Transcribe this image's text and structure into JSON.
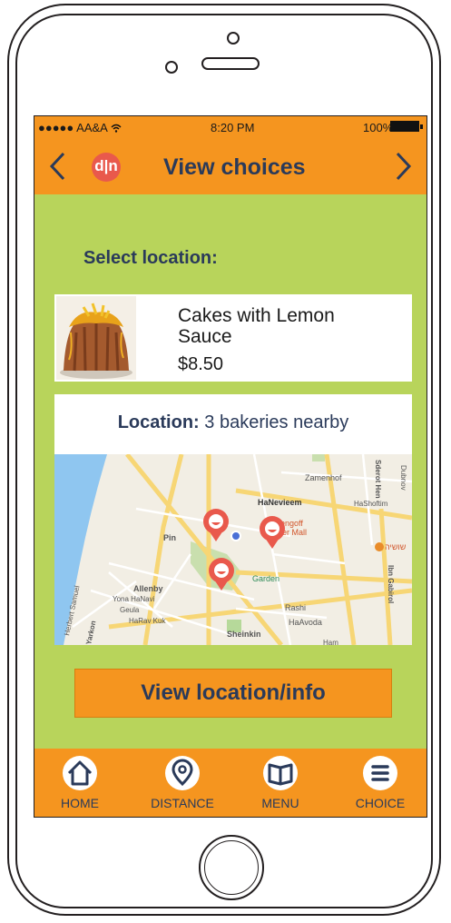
{
  "status_bar": {
    "carrier": "●●●●● AA&A",
    "wifi_icon": "wifi-icon",
    "time": "8:20 PM",
    "battery": "100%"
  },
  "nav": {
    "title": "View choices",
    "logo_text": "d|n",
    "back_icon": "chevron-left-icon",
    "forward_icon": "chevron-right-icon"
  },
  "page": {
    "select_location_label": "Select location:"
  },
  "item": {
    "name": "Cakes with Lemon Sauce",
    "price": "$8.50"
  },
  "location": {
    "label": "Location:",
    "summary": " 3 bakeries nearby"
  },
  "map": {
    "streets": [
      "Zamenhof",
      "HaNevieem",
      "HaShoftim",
      "Dubnov",
      "Sderot Hen",
      "Ibn Gabirol",
      "Allenby",
      "Yona HaNavi",
      "Geula",
      "HaRav Kuk",
      "Herbert Samuel",
      "Yarkon",
      "Rashi",
      "HaAvoda",
      "Sheinkin",
      "Pin",
      "Ham",
      "Garden",
      "Dizengoff Center Mall",
      "שושיה"
    ],
    "markers": 3
  },
  "action": {
    "view_button": "View location/info"
  },
  "tabs": [
    {
      "label": "HOME",
      "icon": "home-icon"
    },
    {
      "label": "DISTANCE",
      "icon": "map-pin-icon"
    },
    {
      "label": "MENU",
      "icon": "book-icon"
    },
    {
      "label": "CHOICE",
      "icon": "list-icon"
    }
  ],
  "colors": {
    "orange": "#f5951f",
    "green": "#b8d45b",
    "navy": "#2a3a5a",
    "logo_red": "#e9594c"
  }
}
